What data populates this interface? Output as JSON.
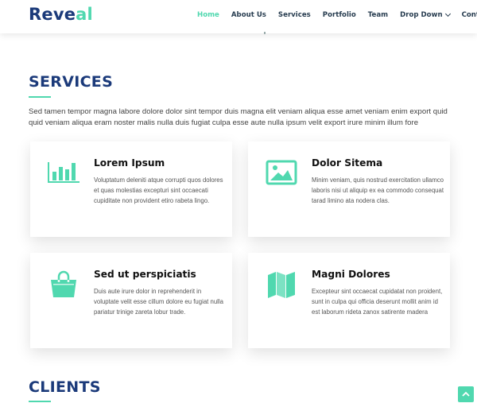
{
  "brand": {
    "part1": "Reve",
    "part2": "al"
  },
  "nav": {
    "items": [
      "Home",
      "About Us",
      "Services",
      "Portfolio",
      "Team",
      "Drop Down",
      "Contact"
    ],
    "active_index": 0
  },
  "services": {
    "title": "SERVICES",
    "intro": "Sed tamen tempor magna labore dolore dolor sint tempor duis magna elit veniam aliqua esse amet veniam enim export quid quid veniam aliqua eram noster malis nulla duis fugiat culpa esse aute nulla ipsum velit export irure minim illum fore",
    "cards": [
      {
        "icon": "bar-chart-icon",
        "title": "Lorem Ipsum",
        "desc": "Voluptatum deleniti atque corrupti quos dolores et quas molestias excepturi sint occaecati cupiditate non provident etiro rabeta lingo."
      },
      {
        "icon": "image-icon",
        "title": "Dolor Sitema",
        "desc": "Minim veniam, quis nostrud exercitation ullamco laboris nisi ut aliquip ex ea commodo consequat tarad limino ata nodera clas."
      },
      {
        "icon": "shopping-bag-icon",
        "title": "Sed ut perspiciatis",
        "desc": "Duis aute irure dolor in reprehenderit in voluptate velit esse cillum dolore eu fugiat nulla pariatur trinige zareta lobur trade."
      },
      {
        "icon": "map-icon",
        "title": "Magni Dolores",
        "desc": "Excepteur sint occaecat cupidatat non proident, sunt in culpa qui officia deserunt mollit anim id est laborum rideta zanox satirente madera"
      }
    ]
  },
  "clients": {
    "title": "CLIENTS"
  },
  "colors": {
    "accent": "#50d8af",
    "heading": "#1b3a7a",
    "nav_text": "#283d50"
  },
  "scroll_top_icon": "chevron-up-icon"
}
